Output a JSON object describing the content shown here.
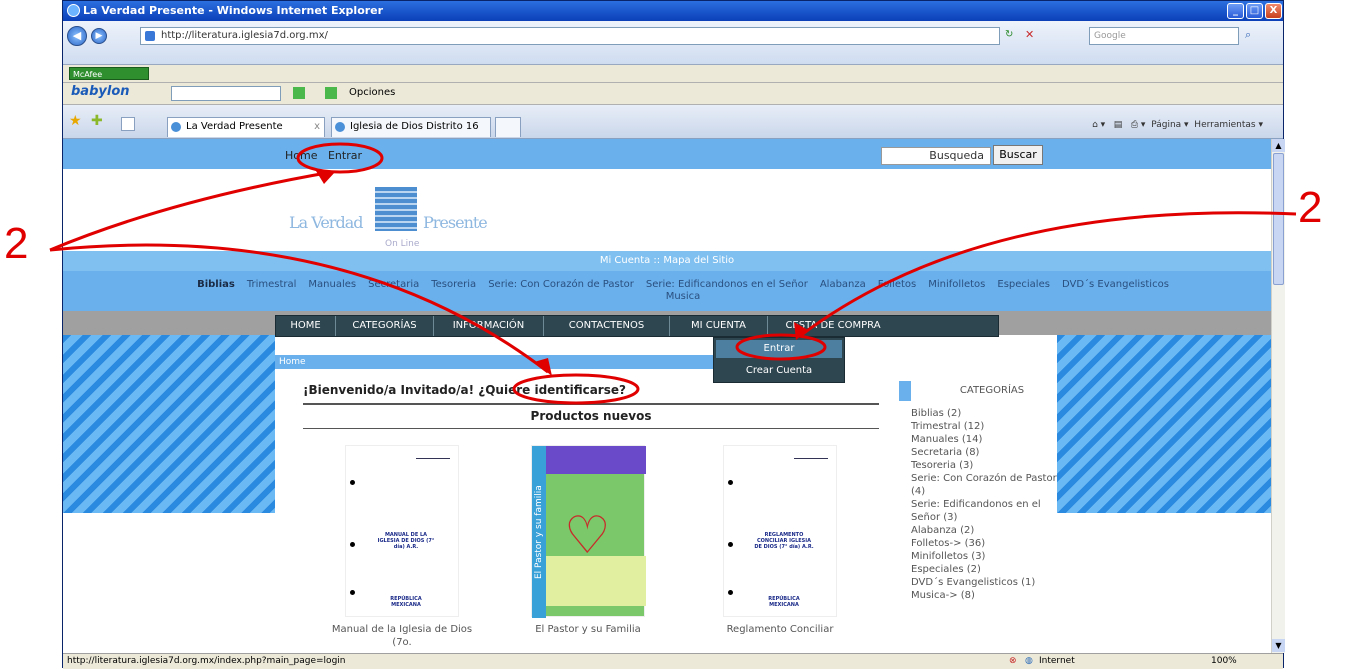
{
  "window": {
    "title": "La Verdad Presente - Windows Internet Explorer",
    "minimize": "_",
    "maximize": "□",
    "close": "X"
  },
  "addressbar": {
    "url": "http://literatura.iglesia7d.org.mx/",
    "search_placeholder": "Google"
  },
  "toolbar": {
    "mcafee": "McAfee SiteAdvisor",
    "babylon": "babylon",
    "opciones": "Opciones"
  },
  "tabs": [
    {
      "label": "La Verdad Presente",
      "close": "x"
    },
    {
      "label": "Iglesia de Dios Distrito 16"
    }
  ],
  "right_tools": {
    "pagina": "Página",
    "herramientas": "Herramientas"
  },
  "site": {
    "top_links": {
      "home": "Home",
      "entrar": "Entrar"
    },
    "search_value": "Busqueda",
    "search_button": "Buscar",
    "logo": {
      "left": "La Verdad",
      "right": "Presente",
      "online": "On Line"
    },
    "account_band": "Mi Cuenta :: Mapa del Sitio",
    "categories_nav": [
      "Biblias",
      "Trimestral",
      "Manuales",
      "Secretaria",
      "Tesoreria",
      "Serie: Con Corazón de Pastor",
      "Serie: Edificandonos en el Señor",
      "Alabanza",
      "Folletos",
      "Minifolletos",
      "Especiales",
      "DVD´s Evangelisticos"
    ],
    "categories_nav_line2": "Musica",
    "main_nav": [
      "HOME",
      "CATEGORÍAS",
      "INFORMACIÓN",
      "CONTACTENOS",
      "MI CUENTA",
      "CESTA DE COMPRA"
    ],
    "submenu": [
      "Entrar",
      "Crear Cuenta"
    ],
    "breadcrumb": "Home",
    "welcome": "¡Bienvenido/a Invitado/a! ¿Quiere identificarse?",
    "new_products": "Productos nuevos",
    "products": [
      {
        "caption": "Manual de la Iglesia de Dios (7o.",
        "doc_text": "MANUAL DE LA IGLESIA DE DIOS (7° día) A.R.",
        "doc_footer": "REPÚBLICA MEXICANA"
      },
      {
        "caption": "El Pastor y su Familia",
        "spine": "El Pastor y su familia"
      },
      {
        "caption": "Reglamento Conciliar",
        "doc_text": "REGLAMENTO CONCILIAR IGLESIA DE DIOS (7° día) A.R.",
        "doc_footer": "REPÚBLICA MEXICANA"
      }
    ],
    "sidebar_title": "CATEGORÍAS",
    "sidebar_items": [
      "Biblias (2)",
      "Trimestral (12)",
      "Manuales (14)",
      "Secretaria (8)",
      "Tesoreria (3)",
      "Serie: Con Corazón de Pastor (4)",
      "Serie: Edificandonos en el Señor (3)",
      "Alabanza (2)",
      "Folletos-> (36)",
      "Minifolletos (3)",
      "Especiales (2)",
      "DVD´s Evangelisticos (1)",
      "Musica-> (8)"
    ]
  },
  "status": {
    "url": "http://literatura.iglesia7d.org.mx/index.php?main_page=login",
    "zone": "Internet",
    "zoom": "100%"
  },
  "annotations": {
    "left_label": "2",
    "right_label": "2",
    "color": "#e00000"
  }
}
